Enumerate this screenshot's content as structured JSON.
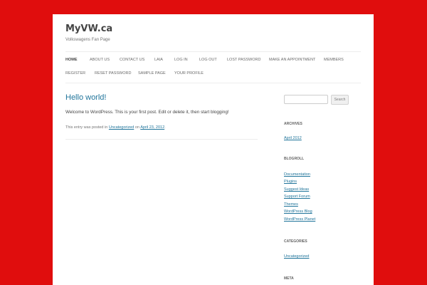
{
  "site": {
    "title": "MyVW.ca",
    "description": "Volkswagens Fan Page"
  },
  "nav": {
    "row1": [
      "HOME",
      "ABOUT US",
      "CONTACT US",
      "LAIA",
      "LOG IN",
      "LOG OUT",
      "LOST PASSWORD",
      "MAKE AN APPOINTMENT",
      "MEMBERS"
    ],
    "row2": [
      "REGISTER",
      "RESET PASSWORD",
      "SAMPLE PAGE",
      "YOUR PROFILE"
    ]
  },
  "post": {
    "title": "Hello world!",
    "body": "Welcome to WordPress. This is your first post. Edit or delete it, then start blogging!",
    "meta_prefix": "This entry was posted in",
    "category": "Uncategorized",
    "meta_on": "on",
    "date": "April 23, 2012",
    "meta_suffix": "."
  },
  "sidebar": {
    "search_button": "Search",
    "archives_title": "ARCHIVES",
    "archives": [
      "April 2012"
    ],
    "blogroll_title": "BLOGROLL",
    "blogroll": [
      "Documentation",
      "Plugins",
      "Suggest Ideas",
      "Support Forum",
      "Themes",
      "WordPress Blog",
      "WordPress Planet"
    ],
    "categories_title": "CATEGORIES",
    "categories": [
      "Uncategorized"
    ],
    "meta_title": "META"
  },
  "colors": {
    "background": "#e00d0d",
    "link": "#21759b"
  }
}
